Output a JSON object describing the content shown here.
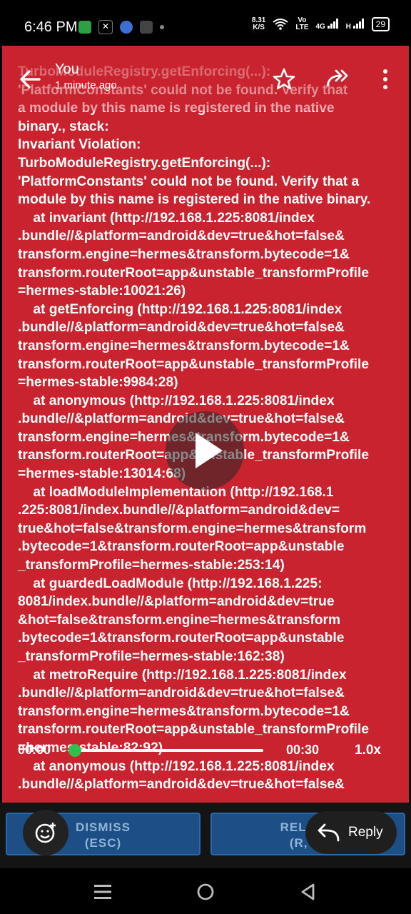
{
  "status_bar": {
    "time": "6:46 PM",
    "speed_value": "8.31",
    "speed_unit": "K/S",
    "network_vo": "Vo",
    "network_lte": "LTE",
    "network_4g": "4G",
    "network_h": "H",
    "battery": "29"
  },
  "viewer": {
    "sender": "You",
    "timestamp": "1 minute ago"
  },
  "video": {
    "error_text": "TurboModuleRegistry.getEnforcing(...):\n'PlatformConstants' could not be found. Verify that\na module by this name is registered in the native\nbinary., stack:\nInvariant Violation:\nTurboModuleRegistry.getEnforcing(...):\n'PlatformConstants' could not be found. Verify that a\nmodule by this name is registered in the native binary.\n    at invariant (http://192.168.1.225:8081/index\n.bundle//&platform=android&dev=true&hot=false&\ntransform.engine=hermes&transform.bytecode=1&\ntransform.routerRoot=app&unstable_transformProfile\n=hermes-stable:10021:26)\n    at getEnforcing (http://192.168.1.225:8081/index\n.bundle//&platform=android&dev=true&hot=false&\ntransform.engine=hermes&transform.bytecode=1&\ntransform.routerRoot=app&unstable_transformProfile\n=hermes-stable:9984:28)\n    at anonymous (http://192.168.1.225:8081/index\n.bundle//&platform=android&dev=true&hot=false&\ntransform.engine=hermes&transform.bytecode=1&\ntransform.routerRoot=app&unstable_transformProfile\n=hermes-stable:13014:68)\n    at loadModuleImplementation (http://192.168.1\n.225:8081/index.bundle//&platform=android&dev=\ntrue&hot=false&transform.engine=hermes&transform\n.bytecode=1&transform.routerRoot=app&unstable\n_transformProfile=hermes-stable:253:14)\n    at guardedLoadModule (http://192.168.1.225:\n8081/index.bundle//&platform=android&dev=true\n&hot=false&transform.engine=hermes&transform\n.bytecode=1&transform.routerRoot=app&unstable\n_transformProfile=hermes-stable:162:38)\n    at metroRequire (http://192.168.1.225:8081/index\n.bundle//&platform=android&dev=true&hot=false&\ntransform.engine=hermes&transform.bytecode=1&\ntransform.routerRoot=app&unstable_transformProfile\n=hermes-stable:82:92)\n    at anonymous (http://192.168.1.225:8081/index\n.bundle//&platform=android&dev=true&hot=false&",
    "current_time": "00:00",
    "duration": "00:30",
    "playback_speed": "1.0x",
    "progress": 0.0
  },
  "buttons": {
    "dismiss_label": "DISMISS",
    "dismiss_key": "(ESC)",
    "reload_label": "RELOAD",
    "reload_key": "(R, R)",
    "reply_label": "Reply"
  },
  "colors": {
    "error_red": "#c8232e",
    "button_blue": "#1d4f86",
    "seek_thumb": "#2fbf4a"
  }
}
